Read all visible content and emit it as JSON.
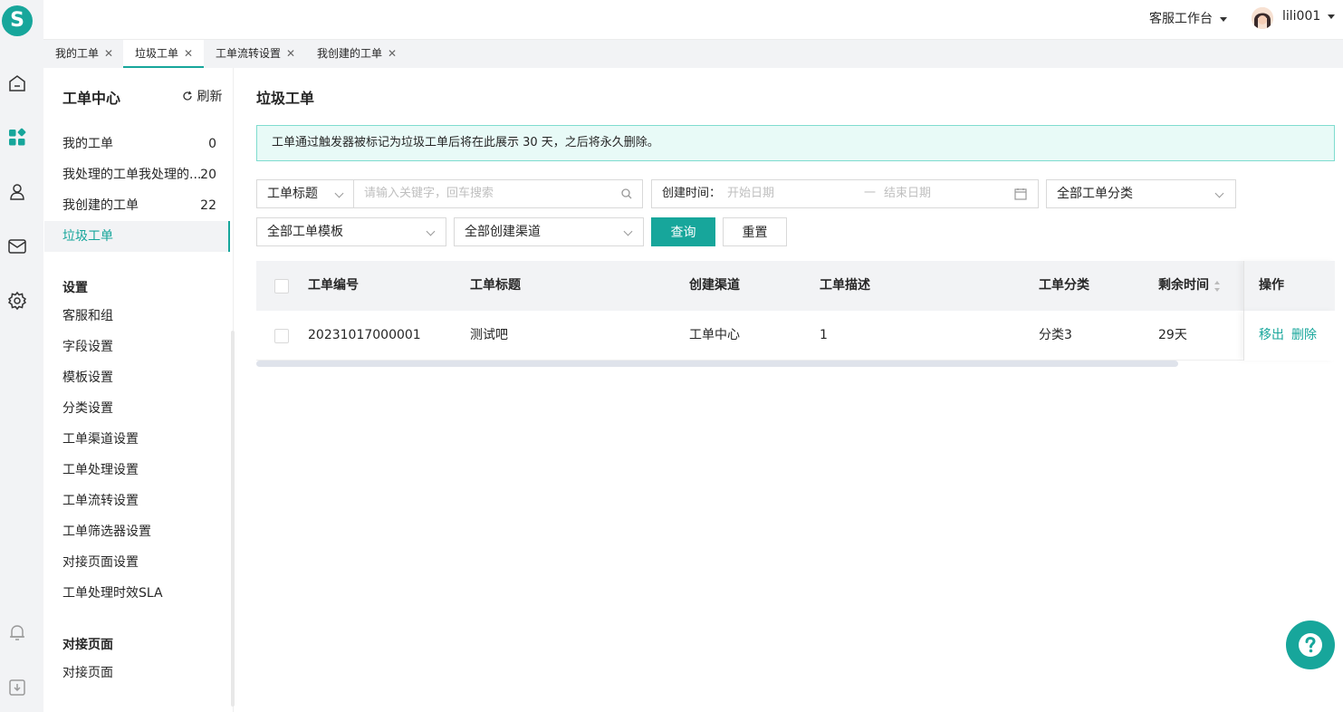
{
  "brand": {
    "logo_letter": "S",
    "accent": "#17a69b"
  },
  "rail": {
    "icons": [
      "home-icon",
      "apps-grid-icon",
      "contacts-icon",
      "mail-icon",
      "settings-icon",
      "bell-icon",
      "download-icon"
    ]
  },
  "topbar": {
    "workbench_label": "客服工作台",
    "username": "lili001"
  },
  "tabs": [
    {
      "label": "我的工单"
    },
    {
      "label": "垃圾工单"
    },
    {
      "label": "工单流转设置"
    },
    {
      "label": "我创建的工单"
    }
  ],
  "sidenav": {
    "title": "工单中心",
    "refresh_label": "刷新",
    "items": [
      {
        "label": "我的工单",
        "count": "0"
      },
      {
        "label": "我处理的工单我处理的...",
        "count": "20"
      },
      {
        "label": "我创建的工单",
        "count": "22"
      },
      {
        "label": "垃圾工单",
        "count": ""
      }
    ],
    "settings_title": "设置",
    "settings_items": [
      "客服和组",
      "字段设置",
      "模板设置",
      "分类设置",
      "工单渠道设置",
      "工单处理设置",
      "工单流转设置",
      "工单筛选器设置",
      "对接页面设置",
      "工单处理时效SLA"
    ],
    "page_section_title": "对接页面",
    "page_items": [
      "对接页面"
    ]
  },
  "main": {
    "title": "垃圾工单",
    "notice": "工单通过触发器被标记为垃圾工单后将在此展示 30 天，之后将永久删除。",
    "filters": {
      "search_field": "工单标题",
      "search_placeholder": "请输入关键字，回车搜索",
      "date_label": "创建时间：",
      "start_placeholder": "开始日期",
      "date_separator": "一",
      "end_placeholder": "结束日期",
      "category": "全部工单分类",
      "template": "全部工单模板",
      "channel": "全部创建渠道",
      "query_button": "查询",
      "reset_button": "重置"
    },
    "table": {
      "columns": [
        "工单编号",
        "工单标题",
        "创建渠道",
        "工单描述",
        "工单分类",
        "剩余时间",
        "操作"
      ],
      "rows": [
        {
          "id": "20231017000001",
          "title": "测试吧",
          "channel": "工单中心",
          "desc": "1",
          "category": "分类3",
          "remaining": "29天",
          "actions": [
            "移出",
            "删除"
          ]
        }
      ]
    }
  }
}
